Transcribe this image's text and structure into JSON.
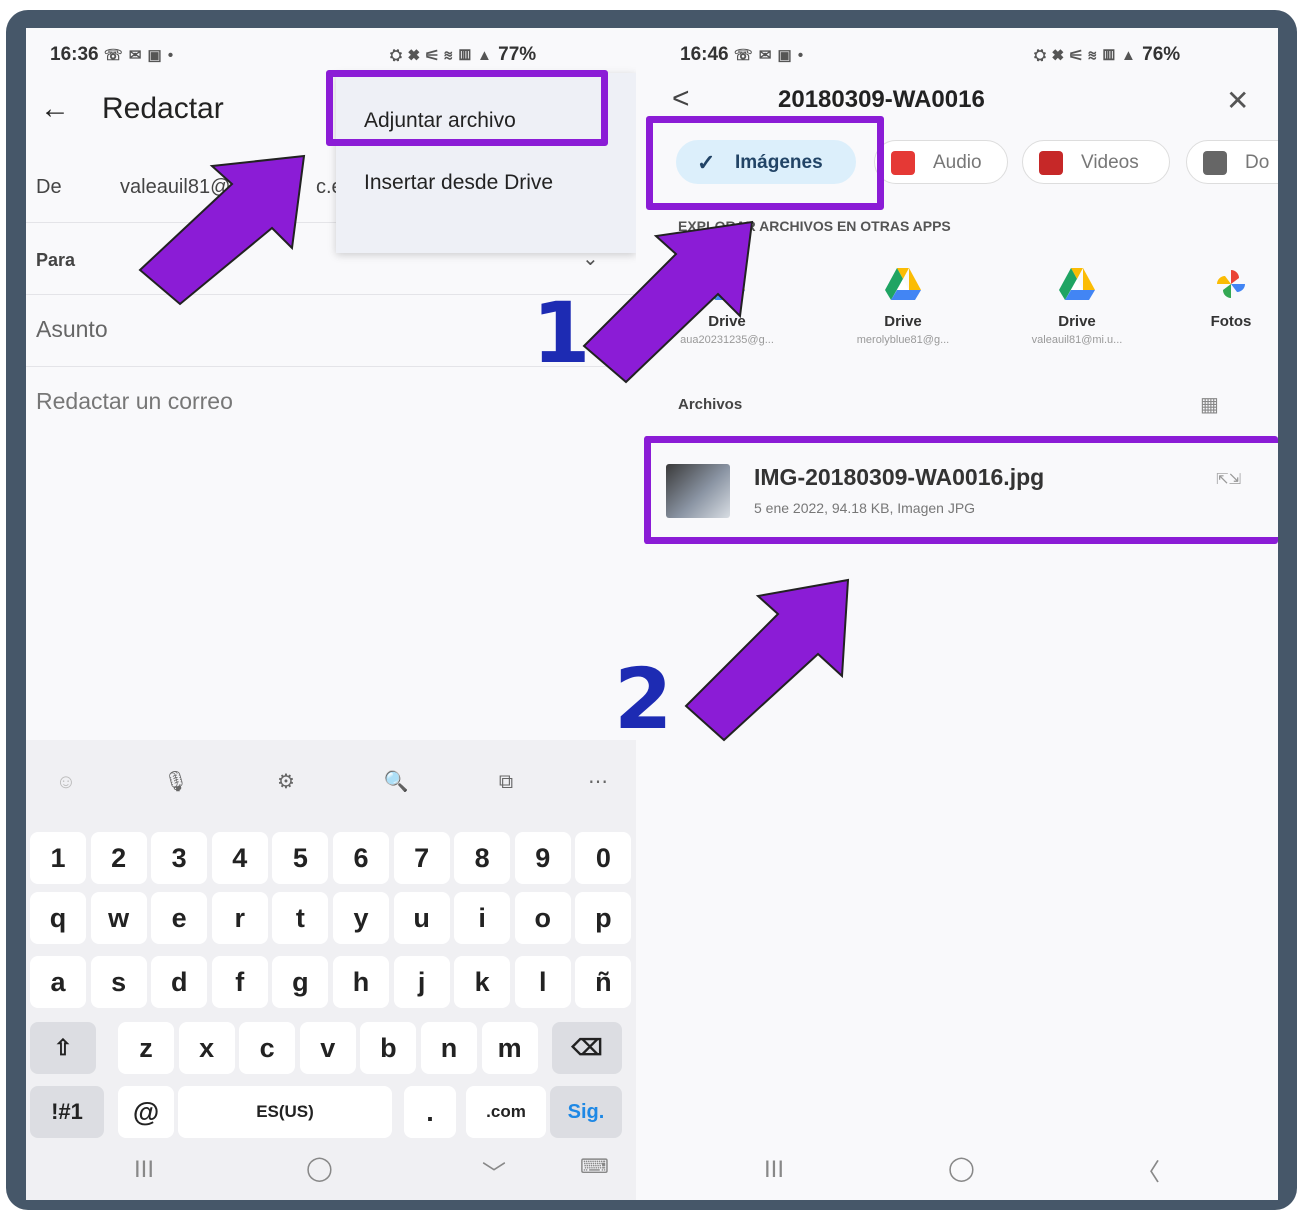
{
  "left": {
    "status": {
      "time": "16:36",
      "icons": "☏ ✉ ▣ •",
      "right_icons": "⛭ ✖ ⚟ ≋ ▥ ▲",
      "battery": "77%"
    },
    "title": "Redactar",
    "from_label": "De",
    "from_value": "valeauil81@",
    "from_value_tail": "c.e",
    "to_label": "Para",
    "subject_placeholder": "Asunto",
    "body_placeholder": "Redactar un correo",
    "menu": {
      "attach": "Adjuntar archivo",
      "drive": "Insertar desde Drive"
    },
    "keyboard": {
      "toolbar": [
        "☺",
        "🎙",
        "⚙",
        "🔍",
        "⧉",
        "⋯"
      ],
      "row_numbers": [
        "1",
        "2",
        "3",
        "4",
        "5",
        "6",
        "7",
        "8",
        "9",
        "0"
      ],
      "row1": [
        "q",
        "w",
        "e",
        "r",
        "t",
        "y",
        "u",
        "i",
        "o",
        "p"
      ],
      "row2": [
        "a",
        "s",
        "d",
        "f",
        "g",
        "h",
        "j",
        "k",
        "l",
        "ñ"
      ],
      "row3": [
        "z",
        "x",
        "c",
        "v",
        "b",
        "n",
        "m"
      ],
      "shift": "⇧",
      "backspace": "⌫",
      "symbols": "!#1",
      "at": "@",
      "space": "ES(US)",
      "dot": ".",
      "dotcom": ".com",
      "go": "Sig."
    },
    "nav": {
      "recent": "III",
      "home": "◯",
      "down": "﹀",
      "kbd": "⌨"
    }
  },
  "right": {
    "status": {
      "time": "16:46",
      "icons": "☏ ✉ ▣ •",
      "right_icons": "⛭ ✖ ⚟ ≋ ▥ ▲",
      "battery": "76%"
    },
    "title": "20180309-WA0016",
    "chips": {
      "images": "Imágenes",
      "audio": "Audio",
      "videos": "Videos",
      "docs": "Do"
    },
    "explore_heading": "EXPLORAR ARCHIVOS EN OTRAS APPS",
    "apps": [
      {
        "name": "Drive",
        "account": "aua20231235@g..."
      },
      {
        "name": "Drive",
        "account": "merolyblue81@g..."
      },
      {
        "name": "Drive",
        "account": "valeauil81@mi.u..."
      },
      {
        "name": "Fotos",
        "account": ""
      }
    ],
    "files_heading": "Archivos",
    "file": {
      "name": "IMG-20180309-WA0016.jpg",
      "meta": "5 ene 2022, 94.18 KB, Imagen JPG"
    },
    "nav": {
      "recent": "III",
      "home": "◯",
      "back": "〈"
    }
  },
  "annotations": {
    "step1": "1",
    "step2": "2"
  },
  "colors": {
    "highlight": "#8b1cd6",
    "step_number": "#1d2bb3",
    "frame": "#465769"
  }
}
